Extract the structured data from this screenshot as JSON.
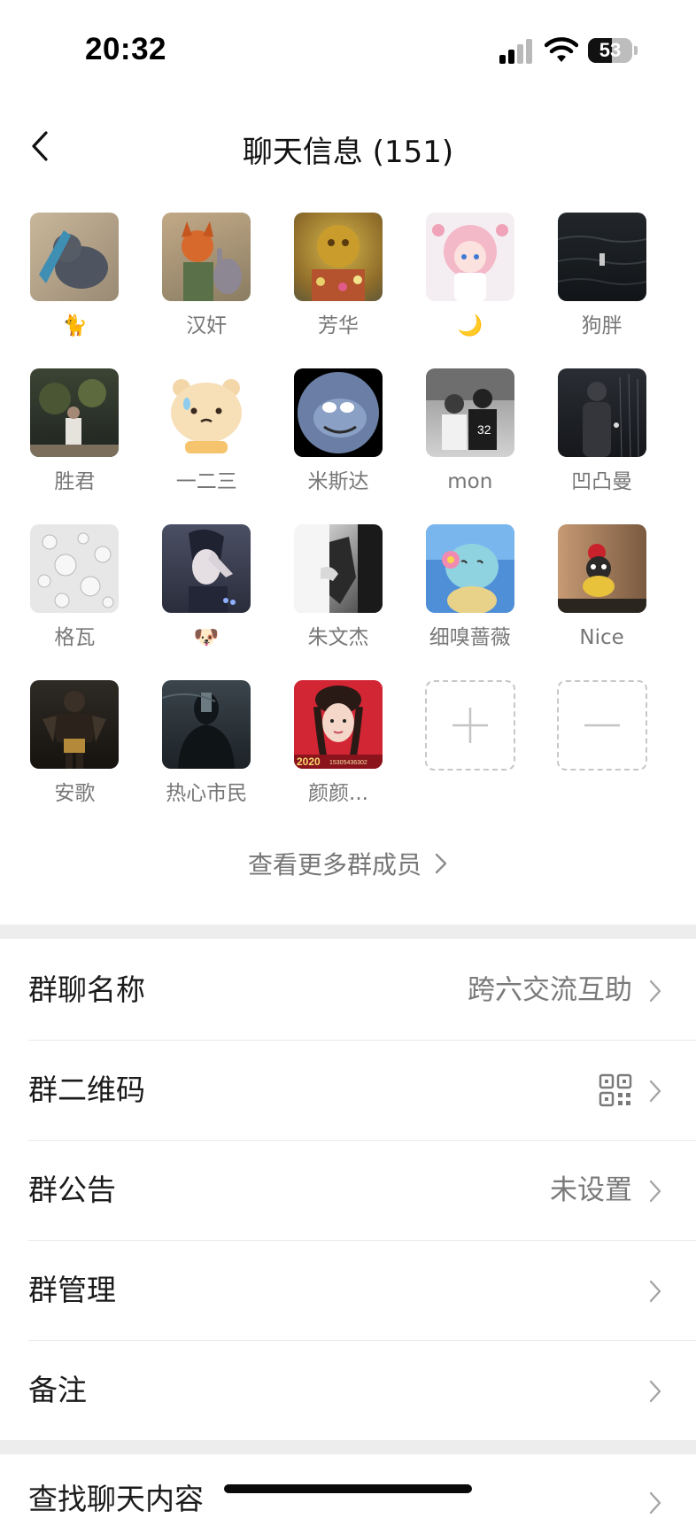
{
  "status_bar": {
    "time": "20:32",
    "battery_percent": "53",
    "battery_level": 0.53,
    "signal_icon": "cellular-signal-icon",
    "wifi_icon": "wifi-icon"
  },
  "header": {
    "title": "聊天信息 (151)",
    "back_icon": "chevron-left-icon"
  },
  "members": [
    {
      "name": "🐈",
      "avatar": "cat-photo"
    },
    {
      "name": "汉奸",
      "avatar": "fox-and-rabbit-cartoon"
    },
    {
      "name": "芳华",
      "avatar": "golden-lion-statue"
    },
    {
      "name": "🌙",
      "avatar": "pink-anime-girl"
    },
    {
      "name": "狗胖",
      "avatar": "dark-ocean"
    },
    {
      "name": "胜君",
      "avatar": "night-park-photo"
    },
    {
      "name": "一二三",
      "avatar": "cute-bear-sticker"
    },
    {
      "name": "米斯达",
      "avatar": "tom-cat-cartoon"
    },
    {
      "name": "mon",
      "avatar": "two-boys-photo"
    },
    {
      "name": "凹凸曼",
      "avatar": "dark-rain-figure"
    },
    {
      "name": "格瓦",
      "avatar": "water-drops"
    },
    {
      "name": "🐶",
      "avatar": "dark-anime-boy"
    },
    {
      "name": "朱文杰",
      "avatar": "black-white-hands"
    },
    {
      "name": "细嗅蔷薇",
      "avatar": "squirtle-with-flower"
    },
    {
      "name": "Nice",
      "avatar": "plush-toy-photo"
    },
    {
      "name": "安歌",
      "avatar": "dark-warrior-art"
    },
    {
      "name": "热心市民",
      "avatar": "dark-silhouette"
    },
    {
      "name": "颜颜...",
      "avatar": "woman-portrait-red",
      "avatar_text": "2020",
      "avatar_subtext": "15305436302"
    }
  ],
  "add_icon": "plus-icon",
  "remove_icon": "minus-icon",
  "see_more": "查看更多群成员",
  "settings": [
    {
      "label": "群聊名称",
      "value": "跨六交流互助"
    },
    {
      "label": "群二维码",
      "value": "",
      "icon": "qr-code-icon"
    },
    {
      "label": "群公告",
      "value": "未设置"
    },
    {
      "label": "群管理",
      "value": ""
    },
    {
      "label": "备注",
      "value": ""
    }
  ],
  "bottom_row": {
    "label": "查找聊天内容"
  },
  "colors": {
    "background": "#ffffff",
    "divider_band": "#ededed",
    "text_primary": "#1b1b1b",
    "text_secondary": "#7a7a7a"
  }
}
